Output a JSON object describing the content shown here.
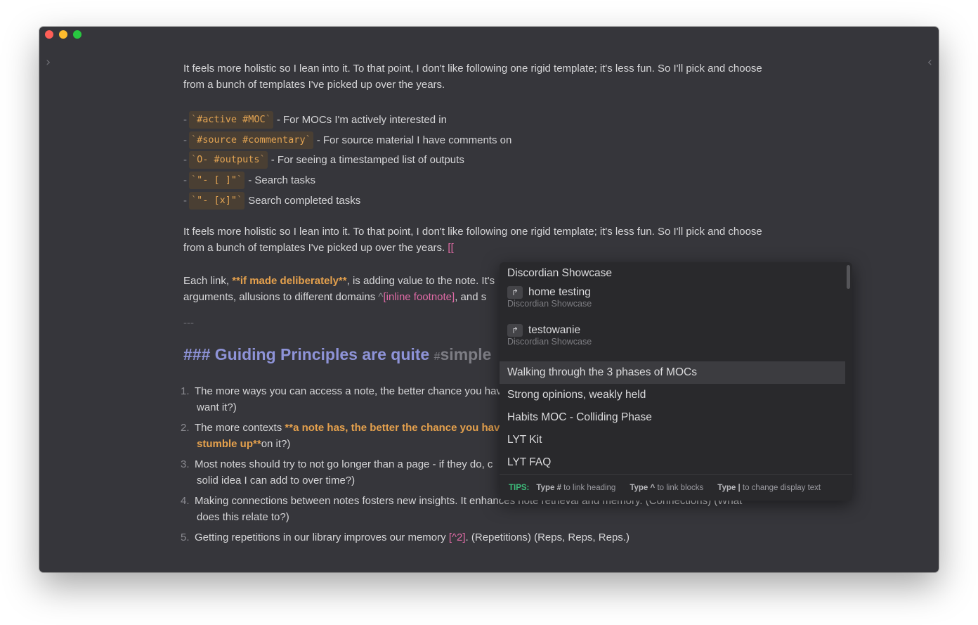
{
  "window": {
    "left_chevron": "›",
    "right_chevron": "‹"
  },
  "editor": {
    "para1": "It feels more holistic so I lean into it. To that point, I don't like following one rigid template; it's less fun. So I'll pick and choose from a bunch of templates I've picked up over the years.",
    "list": [
      {
        "code": "#active #MOC",
        "text": "- For MOCs I'm actively interested in"
      },
      {
        "code": "#source #commentary",
        "text": "- For source material I have comments on"
      },
      {
        "code": "O- #outputs",
        "text": "- For seeing a timestamped list of outputs"
      },
      {
        "code": "\"- [ ]\"",
        "text": "- Search tasks"
      },
      {
        "code": "\"- [x]\"",
        "text": "Search completed tasks"
      }
    ],
    "para2": "It feels more holistic so I lean into it. To that point, I don't like following one rigid template; it's less fun. So I'll pick and choose from a bunch of templates I've picked up over the years.",
    "para2_link": "[[",
    "para3_start": "Each link, ",
    "para3_bold": "**if made deliberately**",
    "para3_mid": ", is adding value to the note. It's",
    "para3_line2_start": "arguments, allusions to different domains ",
    "para3_caret": "^",
    "para3_footnote": "[inline footnote]",
    "para3_end": ", and s",
    "hr": "---",
    "heading_text": "### Guiding Principles are quite ",
    "heading_hash": "#",
    "heading_tag": "simple",
    "ordered": [
      {
        "num": "1.",
        "line1": "The more ways you can access a note, the better chance you hav",
        "line2": "want it?)"
      },
      {
        "num": "2.",
        "line1_start": "The more contexts ",
        "line1_bold": "**a note has, the better the chance you have",
        "line2_bold": "stumble up**",
        "line2_end": "on it?)"
      },
      {
        "num": "3.",
        "line1": "Most notes should try to not go longer than a page - if they do, c",
        "line2": "solid idea I can add to over time?)"
      },
      {
        "num": "4.",
        "line1": "Making connections between notes fosters new insights. It enhances note retrieval and memory. (Connections) (What",
        "line2": "does this relate to?)"
      },
      {
        "num": "5.",
        "line1_start": "Getting repetitions in our library improves our memory ",
        "line1_foot": "[^2]",
        "line1_end": ". (Repetitions) (Reps, Reps, Reps.)"
      }
    ]
  },
  "popup": {
    "items": [
      {
        "title": "Discordian Showcase"
      },
      {
        "title": "home testing",
        "sub": "Discordian Showcase",
        "alias": true
      },
      {
        "title": "testowanie",
        "sub": "Discordian Showcase",
        "alias": true
      },
      {
        "title": "Walking through the 3 phases of MOCs",
        "selected": true
      },
      {
        "title": "Strong opinions, weakly held"
      },
      {
        "title": "Habits MOC - Colliding Phase"
      },
      {
        "title": "LYT Kit"
      },
      {
        "title": "LYT FAQ"
      }
    ],
    "alias_icon": "↱",
    "tips": {
      "label": "TIPS:",
      "t1_bold": "Type #",
      "t1_text": " to link heading",
      "t2_bold": "Type ^",
      "t2_text": " to link blocks",
      "t3_bold": "Type |",
      "t3_text": " to change display text"
    }
  }
}
